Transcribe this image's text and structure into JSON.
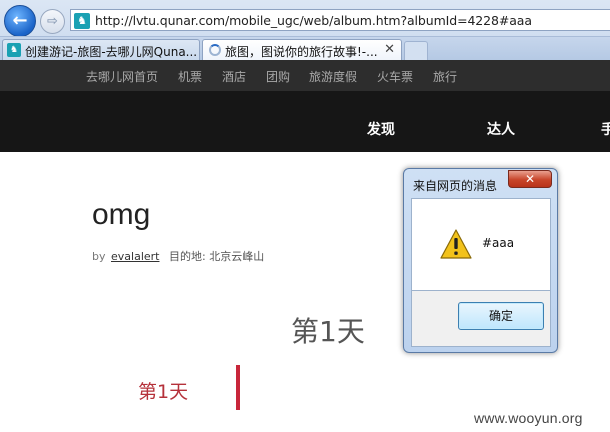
{
  "browser": {
    "back_glyph": "←",
    "forward_glyph": "⇨",
    "url": "http://lvtu.qunar.com/mobile_ugc/web/album.htm?albumId=4228#aaa",
    "tabs": [
      {
        "label": "创建游记-旅图-去哪儿网Quna...",
        "icon": "qunar-camel-icon"
      },
      {
        "label": "旅图，图说你的旅行故事!-...",
        "icon": "loading-spinner-icon",
        "close": "✕"
      }
    ]
  },
  "site": {
    "topbar": [
      "去哪儿网首页",
      "机票",
      "酒店",
      "团购",
      "旅游度假",
      "火车票",
      "旅行"
    ],
    "mainnav": [
      "发现",
      "达人",
      "手"
    ]
  },
  "album": {
    "title": "omg",
    "by": "by",
    "author": "evalalert",
    "destination_label": "目的地:",
    "destination": "北京云峰山",
    "day_heading": "第1天",
    "day_sub": "第1天"
  },
  "dialog": {
    "title": "来自网页的消息",
    "close_glyph": "✕",
    "message": "#aaa",
    "ok_label": "确定"
  },
  "watermark": "www.wooyun.org",
  "colors": {
    "topbar_bg": "#2d2d2d",
    "mainnav_bg": "#161616",
    "accent_red": "#c8263a"
  }
}
